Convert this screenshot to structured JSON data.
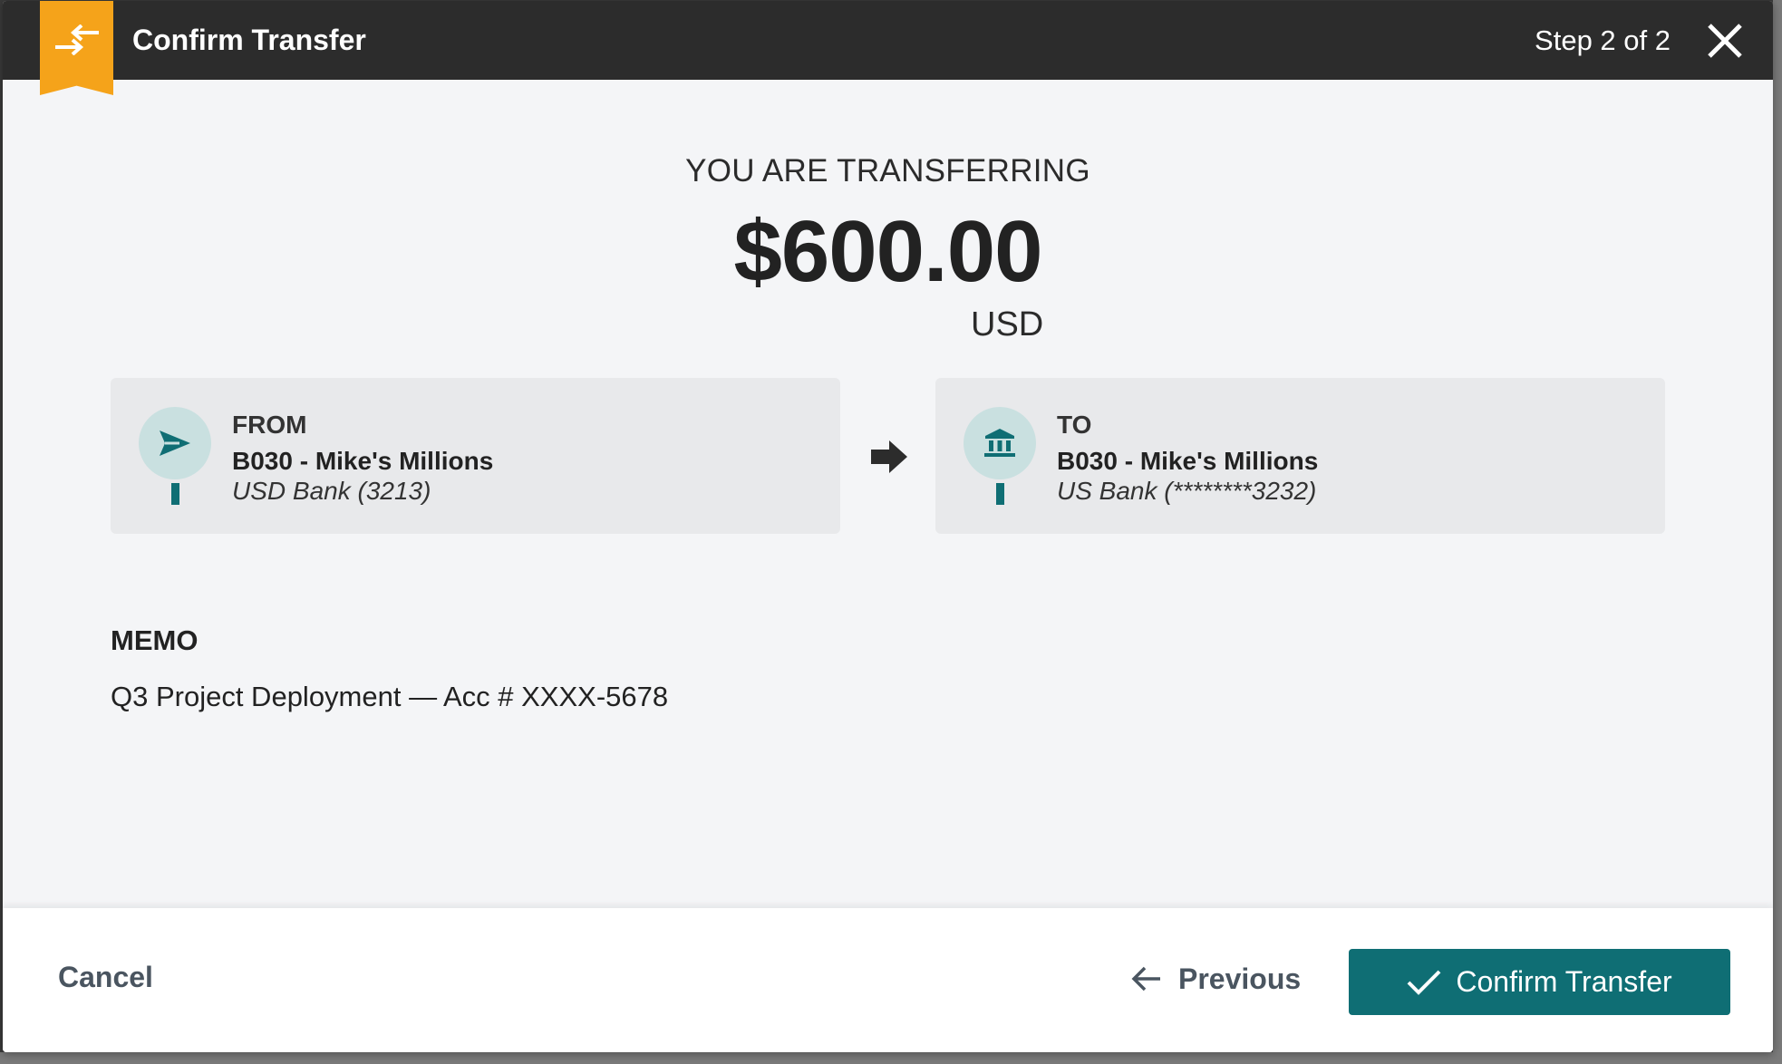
{
  "header": {
    "title": "Confirm Transfer",
    "step": "Step 2 of 2",
    "ribbon_icon": "transfer-arrows-icon",
    "close_icon": "close-icon",
    "accent_color": "#f5a31a",
    "bar_color": "#2c2c2c"
  },
  "amount": {
    "caption": "YOU ARE TRANSFERRING",
    "value": "$600.00",
    "currency": "USD"
  },
  "from": {
    "label": "FROM",
    "name": "B030 - Mike's Millions",
    "sub": "USD Bank (3213)",
    "icon": "send-icon"
  },
  "to": {
    "label": "TO",
    "name": "B030 - Mike's Millions",
    "sub": "US Bank (********3232)",
    "icon": "bank-icon"
  },
  "memo": {
    "heading": "MEMO",
    "text": "Q3 Project Deployment — Acc # XXXX-5678"
  },
  "footer": {
    "cancel_label": "Cancel",
    "previous_label": "Previous",
    "confirm_label": "Confirm Transfer",
    "confirm_color": "#0f6e74"
  }
}
